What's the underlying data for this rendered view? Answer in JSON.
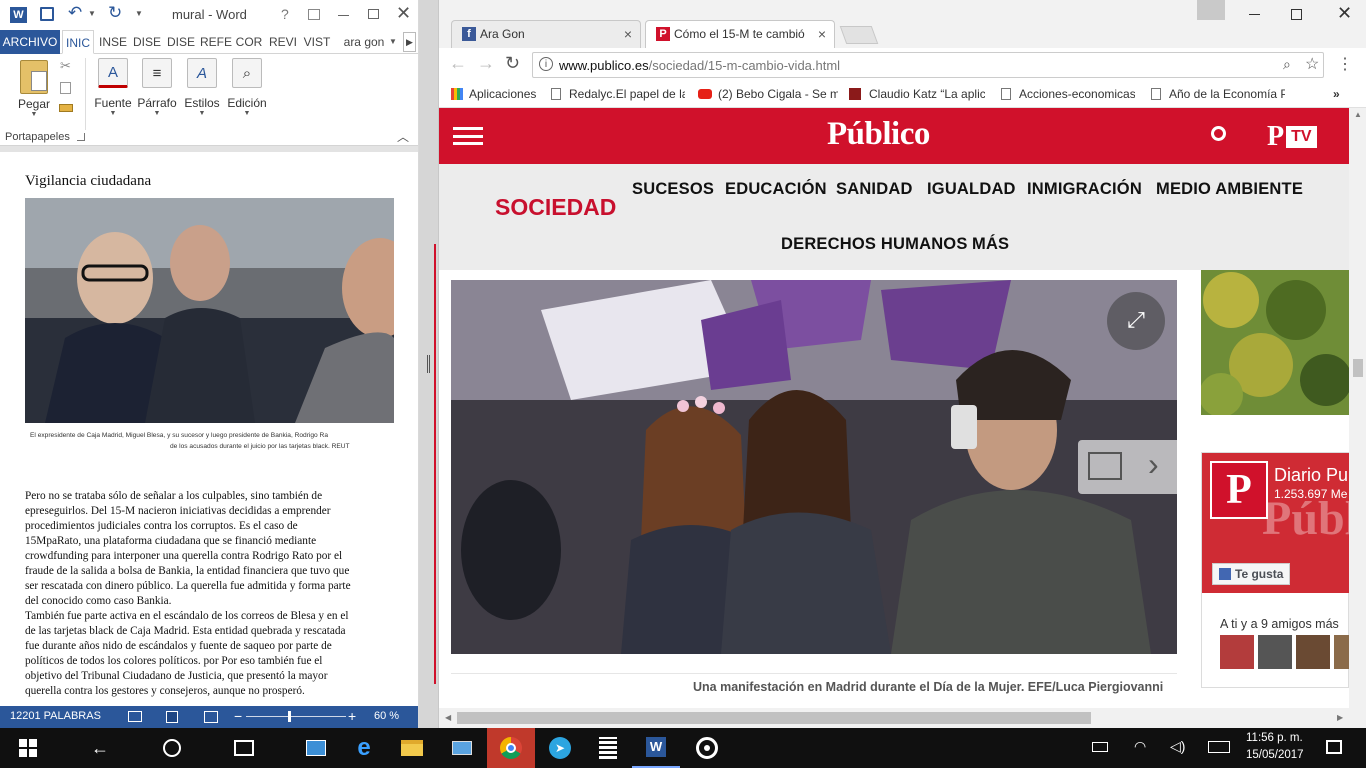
{
  "word": {
    "title": "mural - Word",
    "quick_access": {
      "help": "?",
      "word_icon": "W"
    },
    "tabs": [
      "ARCHIVO",
      "INIC",
      "INSE",
      "DISE",
      "DISE",
      "REFE",
      "COR",
      "REVI",
      "VIST"
    ],
    "user": "ara gon",
    "ribbon": {
      "paste_label": "Pegar",
      "font_label": "Fuente",
      "paragraph_label": "Párrafo",
      "styles_label": "Estilos",
      "edit_label": "Edición",
      "clipboard_group": "Portapapeles"
    },
    "doc": {
      "heading": "Vigilancia ciudadana",
      "caption_l1": "El expresidente de Caja Madrid, Miguel Blesa, y su sucesor y luego presidente de Bankia, Rodrigo Ra",
      "caption_l2": "de los acusados durante el juicio por las tarjetas black. REUT",
      "p1": [
        "Pero no se trataba sólo de señalar a los culpables, sino también de",
        "epreseguirlos. Del 15-M nacieron iniciativas decididas a emprender",
        "procedimientos judiciales contra los corruptos. Es el caso de",
        "15MpaRato, una plataforma ciudadana que se financió mediante",
        "crowdfunding para interponer una querella contra Rodrigo Rato por el",
        "fraude de la salida a bolsa de Bankia, la entidad financiera que tuvo que",
        "ser rescatada con dinero público. La querella fue admitida y forma parte",
        "del conocido como caso Bankia."
      ],
      "p2": [
        "También fue parte activa en el escándalo de los correos de Blesa y en el",
        "de las tarjetas black de Caja Madrid. Esta entidad quebrada y rescatada",
        "fue durante años nido de escándalos y fuente de saqueo por parte de",
        "políticos de todos los colores políticos. por Por eso también fue el",
        "objetivo del Tribunal Ciudadano de Justicia, que presentó la mayor",
        "querella contra los gestores y consejeros, aunque no prosperó."
      ]
    },
    "status": {
      "words": "12201 PALABRAS",
      "zoom": "60 %",
      "zoom_level": 0.42
    }
  },
  "browser": {
    "tabs": [
      {
        "title": "Ara Gon",
        "icon": "f",
        "close": "×"
      },
      {
        "title": "Cómo el 15-M te cambió",
        "icon": "P",
        "close": "×"
      }
    ],
    "url_host": "www.publico.es",
    "url_path": "/sociedad/15-m-cambio-vida.html",
    "bookmarks": [
      "Aplicaciones",
      "Redalyc.El papel de la",
      "(2) Bebo Cigala - Se m",
      "Claudio Katz “La aplic",
      "Acciones-economicas",
      "Año de la Economía P"
    ],
    "page": {
      "brand": "Público",
      "tv_p": "P",
      "tv": "TV",
      "section": "SOCIEDAD",
      "nav": [
        "SUCESOS",
        "EDUCACIÓN",
        "SANIDAD",
        "IGUALDAD",
        "INMIGRACIÓN",
        "MEDIO AMBIENTE",
        "DERECHOS HUMANOS",
        "MÁS"
      ],
      "photo_caption": "Una manifestación en  Madrid durante el Día de la Mujer. EFE/Luca Piergiovanni",
      "fb_name": "Diario Pu",
      "fb_count": "1.253.697 Me",
      "fb_like": "Te gusta",
      "fb_friends": "A ti y a 9 amigos más"
    },
    "colors": {
      "brand_red": "#d0112b",
      "section_red": "#c8102e",
      "nav_gray": "#ececec"
    }
  },
  "taskbar": {
    "time": "11:56 p. m.",
    "date": "15/05/2017"
  }
}
